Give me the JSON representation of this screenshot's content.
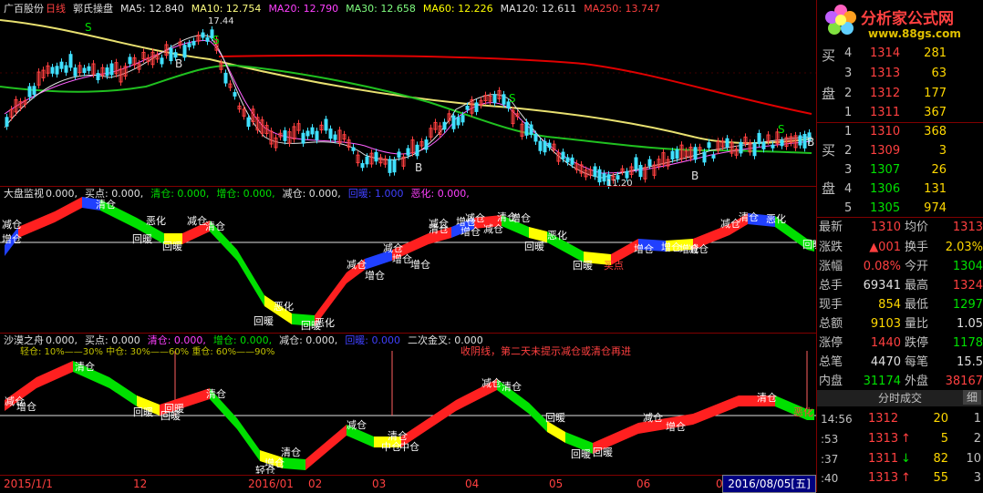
{
  "header": {
    "stock_name": "广百股份",
    "period": "日线",
    "indicator": "郭氏操盘",
    "ma5": "MA5: 12.840",
    "ma10": "MA10: 12.754",
    "ma20": "MA20: 12.790",
    "ma30": "MA30: 12.658",
    "ma60": "MA60: 12.226",
    "ma120": "MA120: 12.611",
    "ma250": "MA250: 13.747"
  },
  "price_labels": {
    "high": "17.44",
    "low": "11.20",
    "markers": [
      "S",
      "S",
      "B",
      "S",
      "B",
      "B",
      "S",
      "B",
      "B"
    ]
  },
  "panel2": {
    "title": "大盘监视",
    "v1": "0.000,",
    "buy": "买点: 0.000,",
    "clear": "清仓: 0.000,",
    "add": "增仓: 0.000,",
    "reduce": "减仓: 0.000,",
    "warm": "回暖: 1.000",
    "bad": "恶化: 0.000,",
    "labels": [
      "减仓",
      "增仓",
      "清仓",
      "恶化",
      "回暖",
      "回暖",
      "减仓",
      "清仓",
      "减仓",
      "增仓",
      "恶化",
      "回暖",
      "回暖",
      "恶化",
      "减仓",
      "增仓",
      "增仓",
      "减仓",
      "增仓",
      "减仓",
      "清仓",
      "增仓",
      "减仓",
      "增仓",
      "清仓",
      "恶化",
      "回暖",
      "回暖",
      "买点",
      "增仓",
      "增仓",
      "增仓",
      "减仓",
      "减仓",
      "清仓",
      "恶化",
      "回暖"
    ]
  },
  "panel3": {
    "title": "沙漠之舟",
    "v1": "0.000,",
    "buy": "买点: 0.000",
    "clear": "清仓: 0.000,",
    "add": "增仓: 0.000,",
    "reduce": "减仓: 0.000,",
    "warm": "回暖: 0.000",
    "golden": "二次金叉: 0.000",
    "legend": "轻仓: 10%——30%   中仓: 30%——60%   重仓: 60%——90%",
    "note": "收阴线，第二天未提示减仓或清仓再进",
    "labels": [
      "减仓",
      "增仓",
      "清仓",
      "回暖",
      "回暖",
      "清仓",
      "回暖",
      "轻仓",
      "清仓",
      "增仓",
      "减仓",
      "清仓",
      "中仓",
      "中仓",
      "减仓",
      "清仓",
      "回暖",
      "回暖",
      "回暖",
      "减仓",
      "增仓",
      "清仓",
      "恶化"
    ]
  },
  "orderbook": {
    "sell_label_1": "买",
    "sell_label_2": "盘",
    "sell": [
      {
        "lvl": "4",
        "px": "1314",
        "vol": "281"
      },
      {
        "lvl": "3",
        "px": "1313",
        "vol": "63"
      },
      {
        "lvl": "2",
        "px": "1312",
        "vol": "177"
      },
      {
        "lvl": "1",
        "px": "1311",
        "vol": "367"
      }
    ],
    "buy_label_1": "买",
    "buy_label_2": "盘",
    "buy": [
      {
        "lvl": "1",
        "px": "1310",
        "vol": "368"
      },
      {
        "lvl": "2",
        "px": "1309",
        "vol": "3"
      },
      {
        "lvl": "3",
        "px": "1307",
        "vol": "26"
      },
      {
        "lvl": "4",
        "px": "1306",
        "vol": "131"
      },
      {
        "lvl": "5",
        "px": "1305",
        "vol": "974"
      }
    ]
  },
  "stats": [
    {
      "k1": "最新",
      "v1": "1310",
      "k2": "均价",
      "v2": "1313"
    },
    {
      "k1": "涨跌",
      "v1": "▲001",
      "k2": "换手",
      "v2": "2.03%"
    },
    {
      "k1": "涨幅",
      "v1": "0.08%",
      "k2": "今开",
      "v2": "1304"
    },
    {
      "k1": "总手",
      "v1": "69341",
      "k2": "最高",
      "v2": "1324"
    },
    {
      "k1": "现手",
      "v1": "854",
      "k2": "最低",
      "v2": "1297"
    },
    {
      "k1": "总额",
      "v1": "9103",
      "k2": "量比",
      "v2": "1.05"
    },
    {
      "k1": "涨停",
      "v1": "1440",
      "k2": "跌停",
      "v2": "1178"
    },
    {
      "k1": "总笔",
      "v1": "4470",
      "k2": "每笔",
      "v2": "15.5"
    },
    {
      "k1": "内盘",
      "v1": "31174",
      "k2": "外盘",
      "v2": "38167"
    }
  ],
  "timesales": {
    "header": "分时成交",
    "fine": "细",
    "rows": [
      {
        "t": "14:56",
        "p": "1312",
        "d": "",
        "v": "20",
        "c": "1"
      },
      {
        "t": ":53",
        "p": "1313",
        "d": "↑",
        "v": "5",
        "c": "2"
      },
      {
        "t": ":37",
        "p": "1311",
        "d": "↓",
        "v": "82",
        "c": "10"
      },
      {
        "t": ":40",
        "p": "1313",
        "d": "↑",
        "v": "55",
        "c": "3"
      }
    ]
  },
  "dates": {
    "d1": "2015/1/1",
    "d2": "12",
    "d3": "2016/01",
    "d4": "02",
    "d5": "03",
    "d6": "04",
    "d7": "05",
    "d8": "06",
    "d9": "0",
    "selected": "2016/08/05[五]"
  },
  "logo": {
    "name": "分析家公式网",
    "url": "www.88gs.com"
  },
  "colors": {
    "up": "#ff4040",
    "down": "#00e000",
    "accent": "#ffd800",
    "grid": "#800000"
  }
}
